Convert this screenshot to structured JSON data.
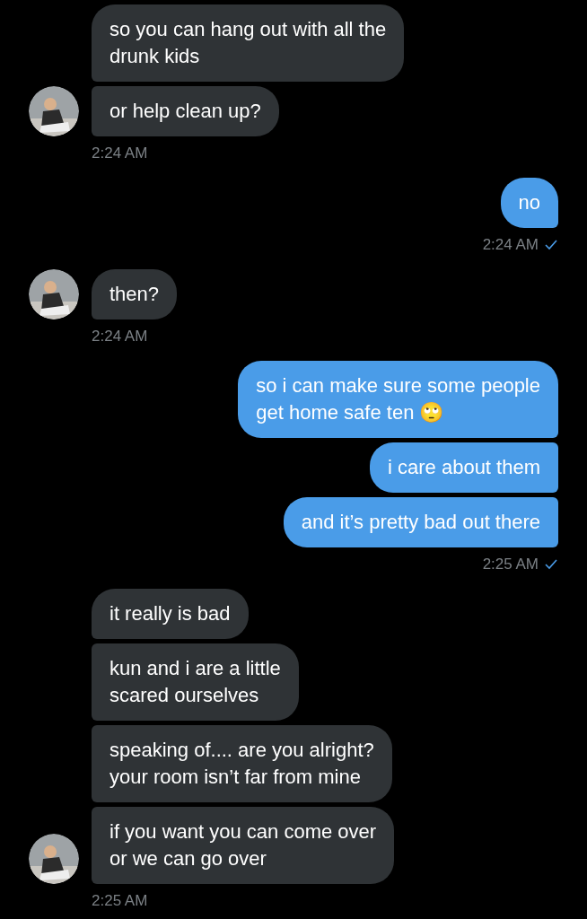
{
  "groups": [
    {
      "kind": "received",
      "messages": [
        "so you can hang out with all the\ndrunk kids",
        "or help clean up?"
      ],
      "time": "2:24 AM"
    },
    {
      "kind": "sent",
      "messages": [
        "no"
      ],
      "time": "2:24 AM",
      "seen": true
    },
    {
      "kind": "received",
      "messages": [
        "then?"
      ],
      "time": "2:24 AM"
    },
    {
      "kind": "sent",
      "messages": [
        "so i can make sure some people\nget home safe ten 🙄",
        "i care about them",
        "and it’s pretty bad out there"
      ],
      "time": "2:25 AM",
      "seen": true
    },
    {
      "kind": "received",
      "messages": [
        "it really is bad",
        "kun and i are a little\nscared ourselves",
        "speaking of.... are you alright?\nyour room isn’t far from mine",
        "if you want you can come over\nor we can go over"
      ],
      "time": "2:25 AM"
    }
  ]
}
